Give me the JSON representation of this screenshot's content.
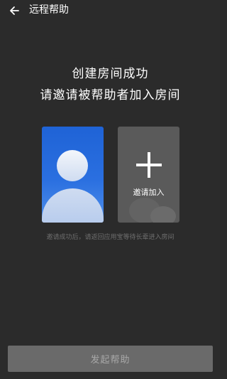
{
  "header": {
    "back_icon": "arrow-left-icon",
    "title": "远程帮助"
  },
  "intro": {
    "line1": "创建房间成功",
    "line2": "请邀请被帮助者加入房间"
  },
  "cards": {
    "user": {
      "icon": "avatar-icon",
      "accent_color": "#1f63d6"
    },
    "invite": {
      "icon": "plus-icon",
      "label": "邀请加入"
    }
  },
  "hint": "邀请成功后，请返回应用宝等待长辈进入房间",
  "action": {
    "label": "发起帮助",
    "state": "disabled"
  }
}
